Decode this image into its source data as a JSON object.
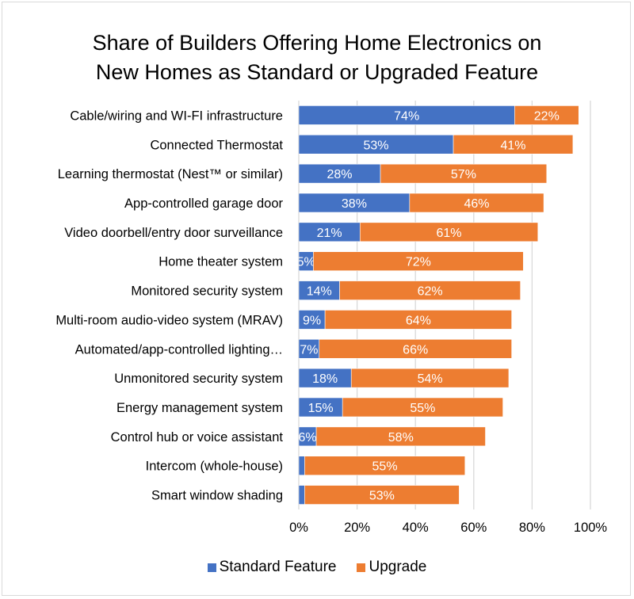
{
  "chart_data": {
    "type": "bar",
    "orientation": "horizontal",
    "stacked": true,
    "title": "Share of Builders Offering Home Electronics on New Homes as Standard or Upgraded Feature",
    "title_lines": [
      "Share of Builders Offering Home Electronics on",
      "New Homes as Standard or Upgraded Feature"
    ],
    "xlabel": "",
    "ylabel": "",
    "xlim": [
      0,
      100
    ],
    "x_ticks": [
      0,
      20,
      40,
      60,
      80,
      100
    ],
    "x_tick_labels": [
      "0%",
      "20%",
      "40%",
      "60%",
      "80%",
      "100%"
    ],
    "grid": true,
    "legend_position": "bottom",
    "categories": [
      "Cable/wiring and WI-FI infrastructure",
      "Connected Thermostat",
      "Learning thermostat (Nest™ or similar)",
      "App-controlled garage door",
      "Video doorbell/entry door surveillance",
      "Home theater system",
      "Monitored security system",
      "Multi-room audio-video system (MRAV)",
      "Automated/app-controlled lighting…",
      "Unmonitored security system",
      "Energy management system",
      "Control hub or voice assistant",
      "Intercom (whole-house)",
      "Smart window shading"
    ],
    "series": [
      {
        "name": "Standard Feature",
        "color": "#4472c4",
        "values": [
          74,
          53,
          28,
          38,
          21,
          5,
          14,
          9,
          7,
          18,
          15,
          6,
          2,
          2
        ],
        "labels": [
          "74%",
          "53%",
          "28%",
          "38%",
          "21%",
          "5%",
          "14%",
          "9%",
          "7%",
          "18%",
          "15%",
          "6%",
          "",
          ""
        ]
      },
      {
        "name": "Upgrade",
        "color": "#ed7d31",
        "values": [
          22,
          41,
          57,
          46,
          61,
          72,
          62,
          64,
          66,
          54,
          55,
          58,
          55,
          53
        ],
        "labels": [
          "22%",
          "41%",
          "57%",
          "46%",
          "61%",
          "72%",
          "62%",
          "64%",
          "66%",
          "54%",
          "55%",
          "58%",
          "55%",
          "53%"
        ]
      }
    ]
  },
  "colors": {
    "grid": "#d9d9d9",
    "border": "#d9d9d9",
    "text": "#000000",
    "bar_label": "#ffffff"
  }
}
